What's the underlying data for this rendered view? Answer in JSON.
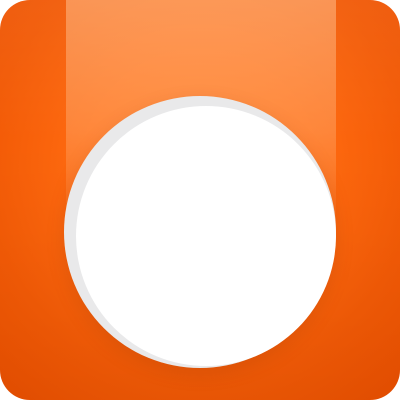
{
  "app_icon": {
    "icon_name": "orange-circle-app-icon",
    "colors": {
      "background_center": "#ff7a1c",
      "background_edge": "#e94f00",
      "beam": "#ffa870",
      "circle": "#ffffff",
      "circle_shadow": "#e9e9ea"
    }
  }
}
